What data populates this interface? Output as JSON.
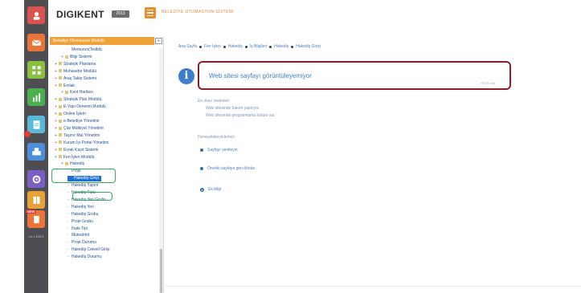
{
  "header": {
    "logo_text": "DIGIKENT",
    "logo_badge": "2013",
    "system_title": "BELEDİYE OTOMASYON SİSTEMİ"
  },
  "rail": {
    "new_badge": "NEW",
    "version": "v4.1.190.0",
    "colors": [
      "#d9534f",
      "#e8763a",
      "#8bbf3f",
      "#4caf50",
      "#5ab8d8",
      "#4a90d9",
      "#7b5fc7",
      "#e8a23a",
      "#e8763a"
    ]
  },
  "tree": {
    "title": "Belediye Otomasyon Modülü",
    "collapse_label": "«",
    "items": [
      {
        "label": "Memurun(Tedbit)",
        "depth": 2
      },
      {
        "label": "Bilgi Sistemi",
        "depth": 1
      },
      {
        "label": "Stratejik Planlama",
        "depth": 0
      },
      {
        "label": "Muhasebe Modülü",
        "depth": 0
      },
      {
        "label": "Araç Takip Sistemi",
        "depth": 0
      },
      {
        "label": "Emlak",
        "depth": 0
      },
      {
        "label": "Kent Haritası",
        "depth": 1
      },
      {
        "label": "Stratejik Plan Modülü",
        "depth": 0
      },
      {
        "label": "E-Yapı Denetim Modülü",
        "depth": 0
      },
      {
        "label": "Online İşlem",
        "depth": 0
      },
      {
        "label": "e-Belediye Yönetimi",
        "depth": 0
      },
      {
        "label": "Çöp Mülkiyet Yönetimi",
        "depth": 0
      },
      {
        "label": "Taşınır Mal Yönetimi",
        "depth": 0
      },
      {
        "label": "Kurum İçi Portal Yönetimi",
        "depth": 0
      },
      {
        "label": "Evrak Kayıt Sistemi",
        "depth": 0
      },
      {
        "label": "Fen İşleri Modülü",
        "depth": 0
      },
      {
        "label": "Hakediş",
        "depth": 1
      },
      {
        "label": "Proje",
        "depth": 2
      },
      {
        "label": "Hakediş Girişi",
        "depth": 2
      },
      {
        "label": "Hakediş Yapım",
        "depth": 2
      },
      {
        "label": "Hakediş Türü",
        "depth": 2
      },
      {
        "label": "Hakediş Yeri Grubu",
        "depth": 2
      },
      {
        "label": "Hakediş Yeri",
        "depth": 2
      },
      {
        "label": "Hakediş Grubu",
        "depth": 2
      },
      {
        "label": "Proje Grubu",
        "depth": 2
      },
      {
        "label": "İhale Tipi",
        "depth": 2
      },
      {
        "label": "Müteahhit",
        "depth": 2
      },
      {
        "label": "Proje Durumu",
        "depth": 2
      },
      {
        "label": "Hakediş Cetveli Girişi",
        "depth": 2
      },
      {
        "label": "Hakediş Durumu",
        "depth": 2
      }
    ]
  },
  "breadcrumbs": [
    "Ana Sayfa",
    "Fen İşleri",
    "Hakediş",
    "İş Bilgileri",
    "Hakediş",
    "Hakediş Girişi"
  ],
  "error": {
    "title": "Web sitesi sayfayı görüntüleyemiyor",
    "code": "HTTP 500"
  },
  "content": {
    "causes_heading": "En olası nedenler:",
    "causes": [
      "Web sitesinde bakım yapılıyor.",
      "Web sitesinde programlama hatası var."
    ],
    "try_heading": "Deneyebilecekleriniz:",
    "links": [
      "Sayfayı yenileyin.",
      "Önceki sayfaya geri dönün."
    ],
    "more_info": "Ek bilgi"
  }
}
